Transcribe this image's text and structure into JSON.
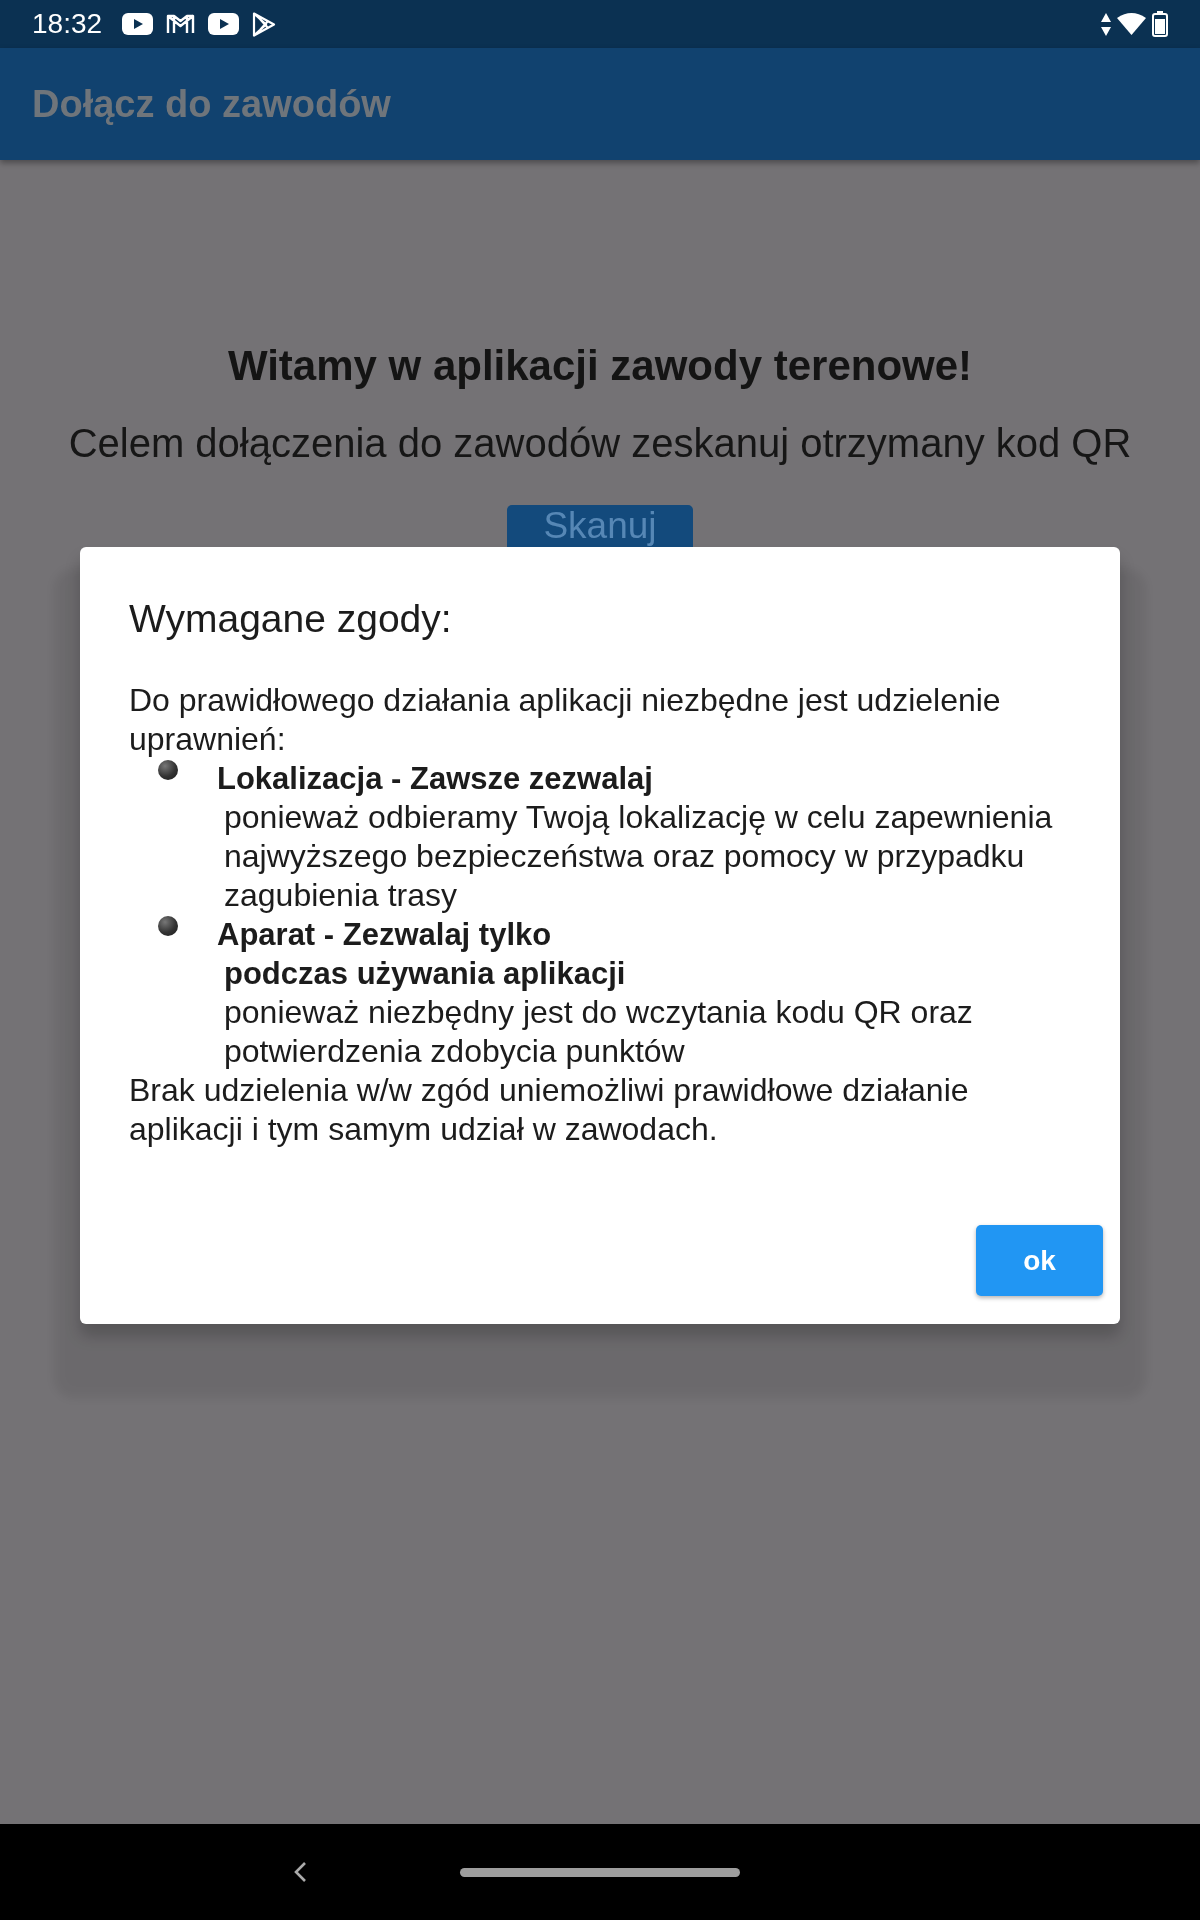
{
  "status_bar": {
    "time": "18:32"
  },
  "app_bar": {
    "title": "Dołącz do zawodów"
  },
  "main": {
    "heading": "Witamy w aplikacji zawody terenowe!",
    "instruction": "Celem dołączenia do zawodów zeskanuj otrzymany kod QR",
    "button": "Skanuj"
  },
  "dialog": {
    "title": "Wymagane zgody:",
    "intro": "Do prawidłowego działania aplikacji niezbędne jest udzielenie uprawnień:",
    "permissions": [
      {
        "title": "Lokalizacja - Zawsze zezwalaj",
        "description": "ponieważ odbieramy Twoją lokalizację w celu zapewnienia najwyższego bezpieczeństwa oraz pomocy w przypadku zagubienia trasy"
      },
      {
        "title": "Aparat - Zezwalaj tylko",
        "description": "**podczas używania aplikacji**\nponieważ niezbędny jest do wczytania kodu QR oraz potwierdzenia zdobycia punktów"
      }
    ],
    "note": "Brak udzielenia w/w zgód uniemożliwi prawidłowe działanie aplikacji i tym samym udział w zawodach.",
    "button": "ok"
  }
}
